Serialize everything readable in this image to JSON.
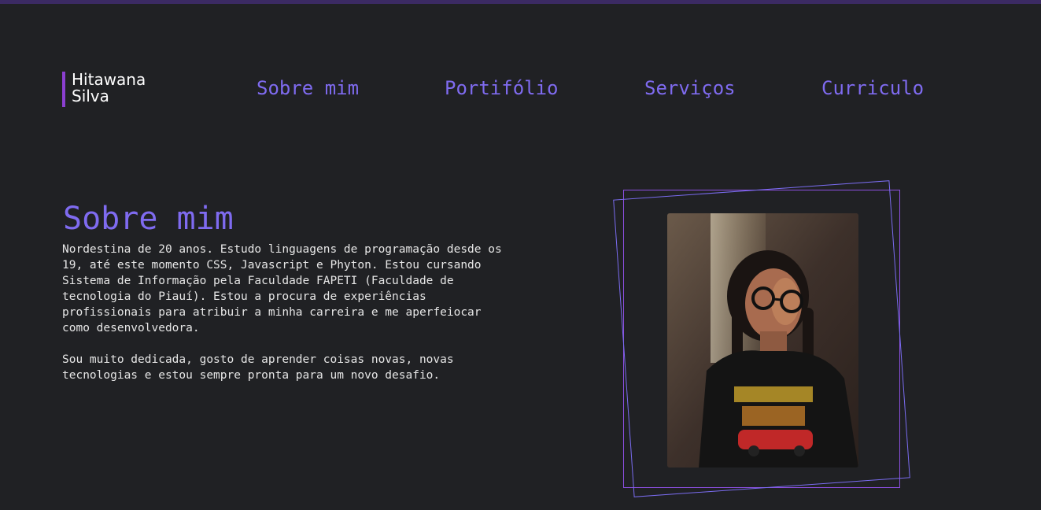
{
  "logo": {
    "line1": "Hitawana",
    "line2": "Silva"
  },
  "nav": {
    "items": [
      {
        "label": "Sobre mim"
      },
      {
        "label": "Portifólio"
      },
      {
        "label": "Serviços"
      },
      {
        "label": "Curriculo"
      }
    ]
  },
  "about": {
    "title": "Sobre mim",
    "paragraph1": "Nordestina de 20 anos. Estudo linguagens de programação desde os 19, até este momento CSS, Javascript e Phyton. Estou cursando Sistema de Informação pela Faculdade FAPETI (Faculdade de tecnologia do Piauí). Estou a procura de experiências profissionais para atribuir a minha carreira e me aperfeiocar como desenvolvedora.",
    "paragraph2": "Sou muito dedicada, gosto de aprender coisas novas, novas tecnologias e estou sempre pronta para um novo desafio."
  },
  "colors": {
    "background": "#202124",
    "accent": "#7f6bf0",
    "logo_bar": "#8b3fd1",
    "text": "#e6e6e6"
  }
}
